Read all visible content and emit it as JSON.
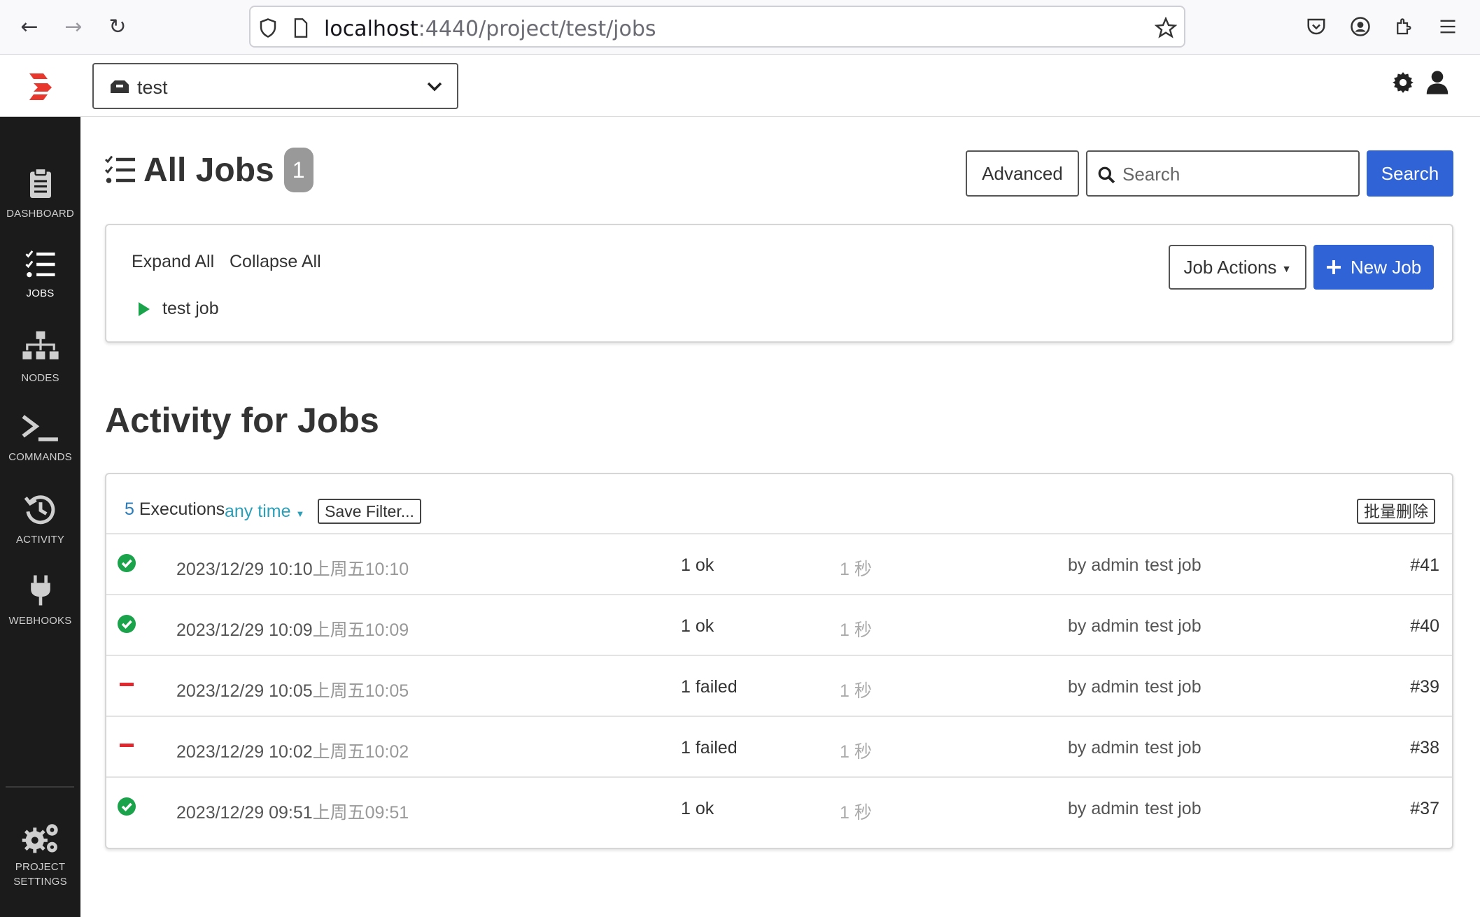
{
  "browser": {
    "url_host": "localhost",
    "url_path": ":4440/project/test/jobs"
  },
  "header": {
    "project_name": "test"
  },
  "sidebar": {
    "items": [
      {
        "label": "DASHBOARD"
      },
      {
        "label": "JOBS"
      },
      {
        "label": "NODES"
      },
      {
        "label": "COMMANDS"
      },
      {
        "label": "ACTIVITY"
      },
      {
        "label": "WEBHOOKS"
      }
    ],
    "settings_line1": "PROJECT",
    "settings_line2": "SETTINGS"
  },
  "page": {
    "title": "All Jobs",
    "job_count": "1",
    "advanced_label": "Advanced",
    "search_placeholder": "Search",
    "search_button": "Search"
  },
  "jobs_panel": {
    "expand_all": "Expand All",
    "collapse_all": "Collapse All",
    "job_actions": "Job Actions",
    "new_job": "New Job",
    "jobs": [
      {
        "name": "test job"
      }
    ]
  },
  "activity": {
    "title": "Activity for Jobs",
    "exec_count": "5",
    "exec_label": "Executions",
    "time_filter": "any time",
    "save_filter": "Save Filter...",
    "bulk_delete": "批量删除",
    "executions": [
      {
        "status": "ok",
        "date": "2023/12/29 10:10",
        "relative": "上周五10:10",
        "result": "1 ok",
        "duration": "1 秒",
        "by": "by admin",
        "job": "test job",
        "number": "#41"
      },
      {
        "status": "ok",
        "date": "2023/12/29 10:09",
        "relative": "上周五10:09",
        "result": "1 ok",
        "duration": "1 秒",
        "by": "by admin",
        "job": "test job",
        "number": "#40"
      },
      {
        "status": "failed",
        "date": "2023/12/29 10:05",
        "relative": "上周五10:05",
        "result": "1 failed",
        "duration": "1 秒",
        "by": "by admin",
        "job": "test job",
        "number": "#39"
      },
      {
        "status": "failed",
        "date": "2023/12/29 10:02",
        "relative": "上周五10:02",
        "result": "1 failed",
        "duration": "1 秒",
        "by": "by admin",
        "job": "test job",
        "number": "#38"
      },
      {
        "status": "ok",
        "date": "2023/12/29 09:51",
        "relative": "上周五09:51",
        "result": "1 ok",
        "duration": "1 秒",
        "by": "by admin",
        "job": "test job",
        "number": "#37"
      }
    ]
  },
  "colors": {
    "primary": "#2f63d6",
    "ok": "#1aa34a",
    "failed": "#e0282e",
    "sidebar": "#1b1b1b"
  }
}
